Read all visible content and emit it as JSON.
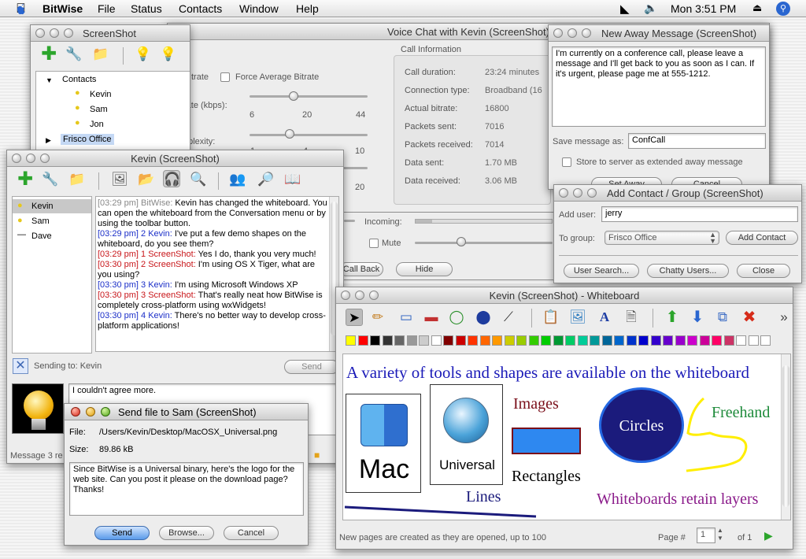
{
  "menubar": {
    "app": "BitWise",
    "items": [
      "File",
      "Status",
      "Contacts",
      "Window",
      "Help"
    ],
    "clock": "Mon 3:51 PM"
  },
  "voice": {
    "title": "Voice Chat with Kevin (ScreenShot)",
    "section_label": "Call Information",
    "bitrate_label_tail": "trate",
    "force_average": "Force Average Bitrate",
    "rate_label_tail": "rate (kbps):",
    "rate_ticks": [
      "6",
      "20",
      "44"
    ],
    "complexity_label_tail": "nplexity:",
    "complexity_ticks": [
      "1",
      "4",
      "10"
    ],
    "quality_tick": "20",
    "incoming_label": "Incoming:",
    "mute_label": "Mute",
    "call_back_label": "Call Back",
    "hide_label": "Hide",
    "info": [
      {
        "label": "Call duration:",
        "value": "23:24 minutes"
      },
      {
        "label": "Connection type:",
        "value": "Broadband (16"
      },
      {
        "label": "Actual bitrate:",
        "value": "16800"
      },
      {
        "label": "Packets sent:",
        "value": "7016"
      },
      {
        "label": "Packets received:",
        "value": "7014"
      },
      {
        "label": "Data sent:",
        "value": "1.70 MB"
      },
      {
        "label": "Data received:",
        "value": "3.06 MB"
      }
    ]
  },
  "buddy": {
    "title": "ScreenShot",
    "group_contacts": "Contacts",
    "contacts": [
      "Kevin",
      "Sam",
      "Jon"
    ],
    "group_frisco": "Frisco Office"
  },
  "away": {
    "title": "New Away Message (ScreenShot)",
    "message": "I'm currently on a conference call, please leave a message and I'll get back to you as soon as I can. If it's urgent, please page me at 555-1212.",
    "save_label": "Save message as:",
    "save_value": "ConfCall",
    "store_label": "Store to server as extended away message",
    "set_away_label": "Set Away",
    "cancel_label": "Cancel"
  },
  "addcontact": {
    "title": "Add Contact / Group (ScreenShot)",
    "user_label": "Add user:",
    "user_value": "jerry",
    "group_label": "To group:",
    "group_value": "Frisco Office",
    "add_button": "Add Contact",
    "user_search": "User Search...",
    "chatty_users": "Chatty Users...",
    "close": "Close"
  },
  "chat": {
    "title": "Kevin (ScreenShot)",
    "participants": [
      "Kevin",
      "Sam",
      "Dave"
    ],
    "messages": [
      {
        "ts": "[03:29 pm] BitWise:",
        "text": " Kevin has changed the whiteboard. You can open the whiteboard from the Conversation menu or by using the toolbar button.",
        "style": "sys"
      },
      {
        "ts": "[03:29 pm] 2 Kevin:",
        "text": " I've put a few demo shapes on the whiteboard, do you see them?",
        "style": "blue"
      },
      {
        "ts": "[03:29 pm] 1 ScreenShot:",
        "text": " Yes I do, thank you very much!",
        "style": "red"
      },
      {
        "ts": "[03:30 pm] 2 ScreenShot:",
        "text": " I'm using OS X Tiger, what are you using?",
        "style": "red"
      },
      {
        "ts": "[03:30 pm] 3 Kevin:",
        "text": " I'm using Microsoft Windows XP",
        "style": "blue"
      },
      {
        "ts": "[03:30 pm] 3 ScreenShot:",
        "text": " That's really neat how BitWise is completely cross-platform using wxWidgets!",
        "style": "red"
      },
      {
        "ts": "[03:30 pm] 4 Kevin:",
        "text": " There's no better way to develop cross-platform applications!",
        "style": "blue"
      }
    ],
    "sending_to": "Sending to: Kevin",
    "send_label": "Send",
    "compose_text": "I couldn't agree more.",
    "status_text": "Message 3 re"
  },
  "sendfile": {
    "title": "Send file to Sam (ScreenShot)",
    "file_label": "File:",
    "file_value": "/Users/Kevin/Desktop/MacOSX_Universal.png",
    "size_label": "Size:",
    "size_value": "89.86 kB",
    "message": "Since BitWise is a Universal binary, here's the logo for the web site. Can you post it please on the download page? Thanks!",
    "send_label": "Send",
    "browse_label": "Browse...",
    "cancel_label": "Cancel"
  },
  "whiteboard": {
    "title": "Kevin (ScreenShot) - Whiteboard",
    "heading": "A variety of tools and shapes are available on the whiteboard",
    "mac_label": "Mac",
    "universal_label": "Universal",
    "images_label": "Images",
    "rectangles_label": "Rectangles",
    "circles_label": "Circles",
    "freehand_label": "Freehand",
    "lines_label": "Lines",
    "layers_label": "Whiteboards retain layers",
    "status_text": "New pages are created as they are opened, up to 100",
    "page_label": "Page #",
    "page_value": "1",
    "page_of": "of 1",
    "palette": [
      "#ffff00",
      "#ff0000",
      "#000000",
      "#333333",
      "#666666",
      "#999999",
      "#cccccc",
      "#ffffff",
      "#800000",
      "#cc0000",
      "#ff3300",
      "#ff6600",
      "#ff9900",
      "#cccc00",
      "#99cc00",
      "#33cc00",
      "#00cc00",
      "#009933",
      "#00cc66",
      "#00cc99",
      "#009999",
      "#006699",
      "#0066cc",
      "#0033cc",
      "#0000cc",
      "#3300cc",
      "#6600cc",
      "#9900cc",
      "#cc00cc",
      "#cc0099",
      "#ff0066",
      "#cc3366",
      "#ffffff",
      "#ffffff",
      "#ffffff"
    ]
  }
}
